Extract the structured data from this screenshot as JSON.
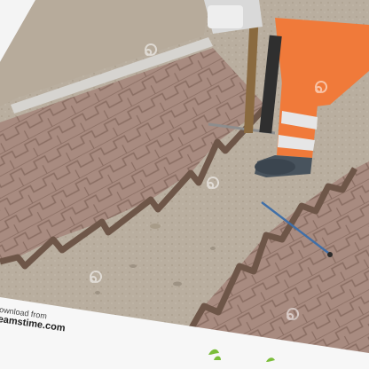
{
  "photo": {
    "scene": "paving-stone-repair",
    "watermark": {
      "lines": [
        "ownload from",
        "eamstime.com",
        ""
      ],
      "swirl_icon": "dreamstime-swirl-icon",
      "footer_icon": "dreamstime-leaf-logo"
    },
    "colors": {
      "sand": "#b8ad9d",
      "paver": "#a88b80",
      "paver_shadow": "#6e5648",
      "trousers": "#f07a3a",
      "reflective": "#e3e3e3",
      "boot": "#4b5660",
      "curb": "#cfcfcf",
      "frame": "#f7f7f7"
    }
  }
}
